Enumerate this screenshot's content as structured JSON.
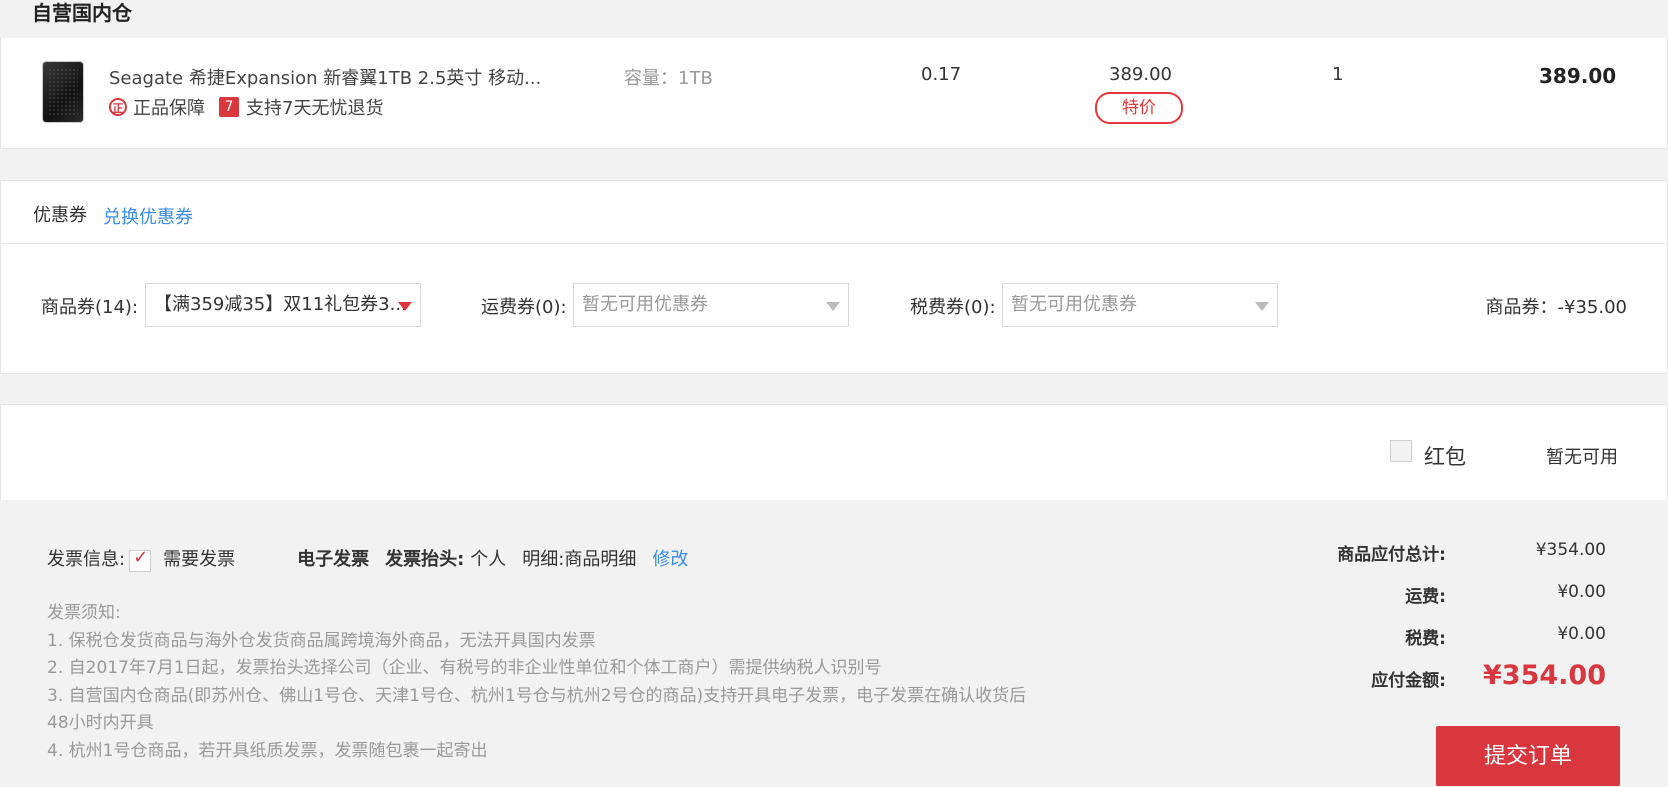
{
  "warehouse": {
    "title": "自营国内仓"
  },
  "product": {
    "name": "Seagate 希捷Expansion 新睿翼1TB 2.5英寸 移动...",
    "tags": {
      "genuine": "正品保障",
      "genuine_icon_text": "正",
      "return_icon_text": "7",
      "return": "支持7天无忧退货"
    },
    "spec": "容量：1TB",
    "weight": "0.17",
    "price": "389.00",
    "badge": "特价",
    "quantity": "1",
    "subtotal": "389.00"
  },
  "coupon": {
    "label": "优惠券",
    "exchange_link": "兑换优惠券",
    "goods": {
      "label": "商品券(14):",
      "value": "【满359减35】双11礼包券3..."
    },
    "freight": {
      "label": "运费券(0):",
      "placeholder": "暂无可用优惠券"
    },
    "tax": {
      "label": "税费券(0):",
      "placeholder": "暂无可用优惠券"
    },
    "summary": "商品券：-¥35.00"
  },
  "red_packet": {
    "label": "红包",
    "status": "暂无可用"
  },
  "invoice": {
    "label": "发票信息:",
    "check_label": "需要发票",
    "type": "电子发票",
    "head_label": "发票抬头:",
    "head_value": "个人",
    "detail": "明细:商品明细",
    "edit": "修改",
    "notice_title": "发票须知:",
    "notices": [
      "1. 保税仓发货商品与海外仓发货商品属跨境海外商品，无法开具国内发票",
      "2. 自2017年7月1日起，发票抬头选择公司（企业、有税号的非企业性单位和个体工商户）需提供纳税人识别号",
      "3. 自营国内仓商品(即苏州仓、佛山1号仓、天津1号仓、杭州1号仓与杭州2号仓的商品)支持开具电子发票，电子发票在确认收货后48小时内开具",
      "4. 杭州1号仓商品，若开具纸质发票，发票随包裹一起寄出"
    ]
  },
  "totals": {
    "goods_label": "商品应付总计:",
    "goods_value": "¥354.00",
    "freight_label": "运费:",
    "freight_value": "¥0.00",
    "tax_label": "税费:",
    "tax_value": "¥0.00",
    "payable_label": "应付金额:",
    "payable_value": "¥354.00"
  },
  "submit": {
    "label": "提交订单"
  }
}
